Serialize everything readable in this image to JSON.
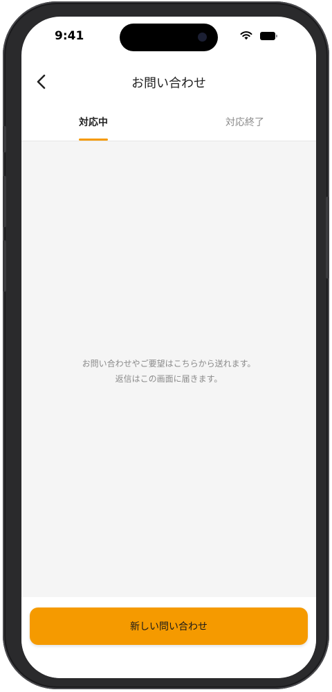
{
  "status_bar": {
    "time": "9:41"
  },
  "nav": {
    "title": "お問い合わせ"
  },
  "tabs": [
    {
      "label": "対応中",
      "active": true
    },
    {
      "label": "対応終了",
      "active": false
    }
  ],
  "empty_state": {
    "line1": "お問い合わせやご要望はこちらから送れます。",
    "line2": "返信はこの画面に届きます。"
  },
  "actions": {
    "new_inquiry_label": "新しい問い合わせ"
  },
  "colors": {
    "accent": "#f59a00",
    "content_background": "#f5f5f5",
    "muted_text": "#8a8a8a"
  },
  "icons": {
    "back": "chevron-left-icon",
    "wifi": "wifi-icon",
    "battery": "battery-icon"
  }
}
